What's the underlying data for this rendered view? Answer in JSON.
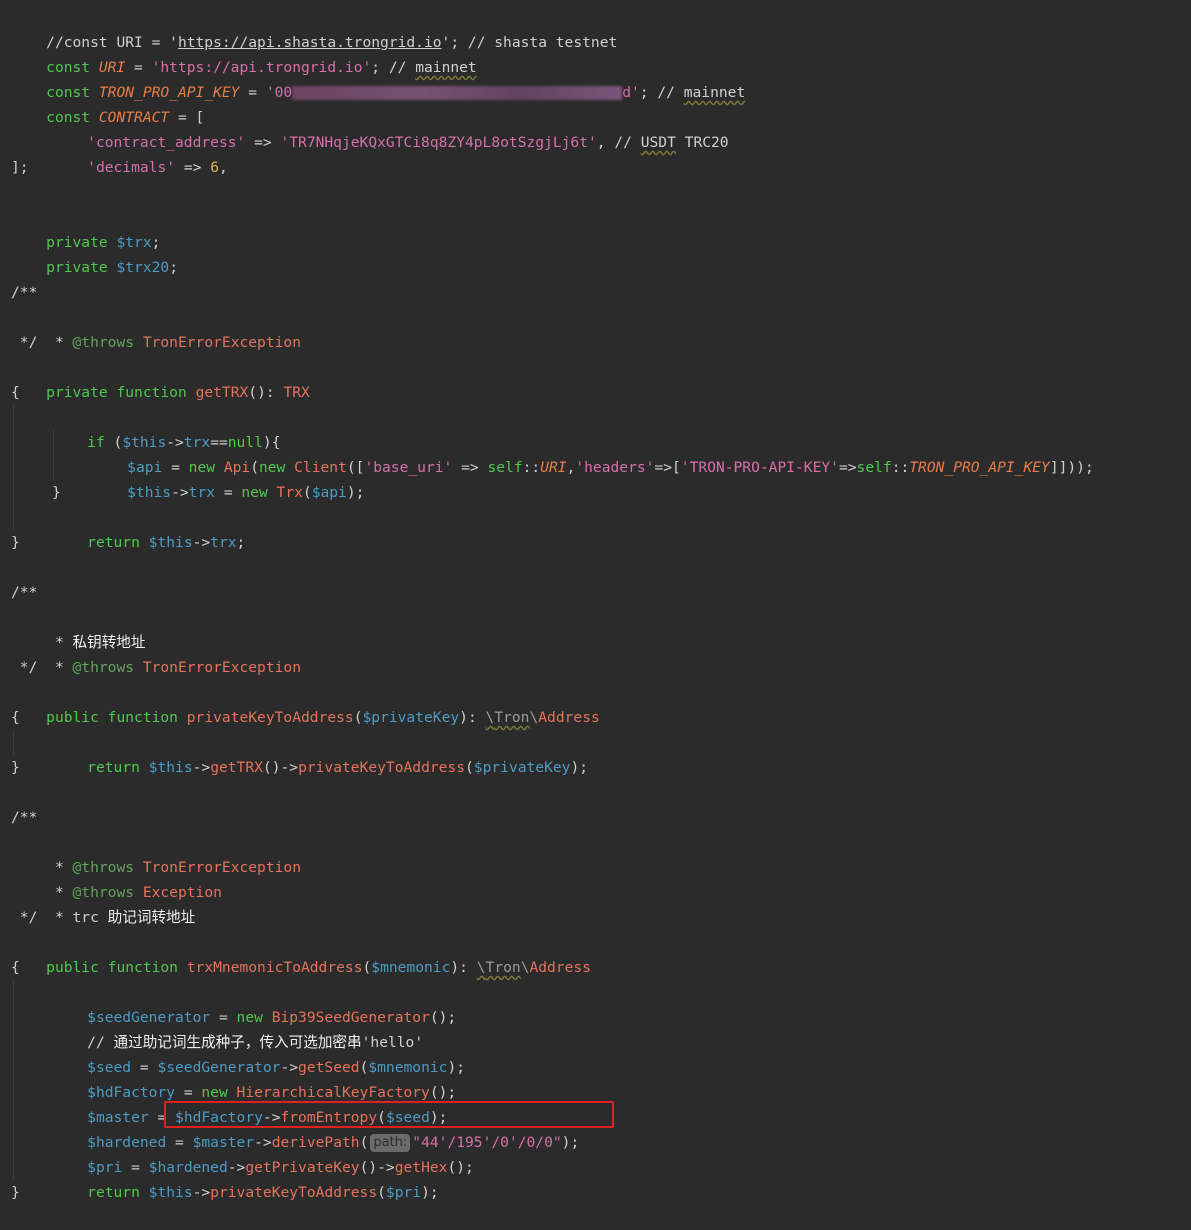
{
  "lines": {
    "l1": {
      "a": "//const URI = '",
      "b": "https://api.shasta.trongrid.io",
      "c": "'; // shasta testnet"
    },
    "l2": {
      "kw": "const",
      "name": "URI",
      "eq": " = ",
      "val": "'https://api.trongrid.io'",
      "semi": "; //",
      "comment": "mainnet"
    },
    "l3": {
      "kw": "const",
      "name": "TRON_PRO_API_KEY",
      "eq": " = ",
      "val_start": "'00",
      "val_end": "d'",
      "semi": "; //",
      "comment": "mainnet"
    },
    "l4": {
      "kw": "const",
      "name": "CONTRACT",
      "rest": " = ["
    },
    "l5": {
      "key": "'contract_address'",
      "arrow": " => ",
      "val": "'TR7NHqjeKQxGTCi8q8ZY4pL8otSzgjLj6t'",
      "semi": ", // ",
      "c1": "USDT",
      "c2": " TRC20"
    },
    "l6": {
      "key": "'decimals'",
      "arrow": " => ",
      "num": "6",
      "semi": ","
    },
    "l7": "];",
    "l9": {
      "kw": "private",
      "var": "$trx",
      "semi": ";"
    },
    "l10": {
      "kw": "private",
      "var": "$trx20",
      "semi": ";"
    },
    "l12": "/**",
    "l13": {
      "star": " * ",
      "tag": "@throws",
      "cls": "TronErrorException"
    },
    "l14": " */",
    "l15": {
      "kw1": "private",
      "kw2": "function",
      "fn": "getTRX",
      "paren": "(): ",
      "ret": "TRX"
    },
    "l16": "{",
    "l17": {
      "kw": "if",
      "p1": " (",
      "var": "$this",
      "arrow": "->",
      "prop": "trx",
      "op": "==",
      "nul": "null",
      "p2": "){"
    },
    "l18": {
      "var": "$api",
      "eq": " = ",
      "kw": "new",
      "cls1": "Api",
      "p1": "(",
      "kw2": "new",
      "cls2": "Client",
      "p2": "([",
      "k1": "'base_uri'",
      "arrow": " => ",
      "self1": "self",
      "dc1": "::",
      "c1": "URI",
      "comma": ",",
      "k2": "'headers'",
      "arrow2": "=>[",
      "k3": "'TRON-PRO-API-KEY'",
      "arrow3": "=>",
      "self2": "self",
      "dc2": "::",
      "c2": "TRON_PRO_API_KEY",
      "end": "]]));"
    },
    "l19": {
      "var": "$this",
      "arrow": "->",
      "prop": "trx",
      "eq": " = ",
      "kw": "new",
      "cls": "Trx",
      "p1": "(",
      "arg": "$api",
      "p2": ");"
    },
    "l20": "}",
    "l21": {
      "kw": "return",
      "var": "$this",
      "arrow": "->",
      "prop": "trx",
      "semi": ";"
    },
    "l22": "}",
    "l24": "/**",
    "l25": {
      "star": " * ",
      "text": "私钥转地址"
    },
    "l26": {
      "star": " * ",
      "tag": "@throws",
      "cls": "TronErrorException"
    },
    "l27": " */",
    "l28": {
      "kw1": "public",
      "kw2": "function",
      "fn": "privateKeyToAddress",
      "p1": "(",
      "arg": "$privateKey",
      "p2": "): ",
      "ns1": "\\",
      "ns2": "Tron",
      "ns3": "\\",
      "ret": "Address"
    },
    "l29": "{",
    "l30": {
      "kw": "return",
      "var": "$this",
      "arrow": "->",
      "fn1": "getTRX",
      "p1": "()->",
      "fn2": "privateKeyToAddress",
      "p2": "(",
      "arg": "$privateKey",
      "p3": ");"
    },
    "l31": "}",
    "l33": "/**",
    "l34": {
      "star": " * ",
      "tag": "@throws",
      "cls": "TronErrorException"
    },
    "l35": {
      "star": " * ",
      "tag": "@throws",
      "cls": "Exception"
    },
    "l36": {
      "star": " * ",
      "text1": "trc ",
      "text2": "助记词转地址"
    },
    "l37": " */",
    "l38": {
      "kw1": "public",
      "kw2": "function",
      "fn": "trxMnemonicToAddress",
      "p1": "(",
      "arg": "$mnemonic",
      "p2": "): ",
      "ns1": "\\",
      "ns2": "Tron",
      "ns3": "\\",
      "ret": "Address"
    },
    "l39": "{",
    "l40": {
      "var": "$seedGenerator",
      "eq": " = ",
      "kw": "new",
      "cls": "Bip39SeedGenerator",
      "p": "();"
    },
    "l41": {
      "slashes": "// ",
      "text": "通过助记词生成种子，传入可选加密串",
      "str": "'hello'"
    },
    "l42": {
      "var": "$seed",
      "eq": " = ",
      "var2": "$seedGenerator",
      "arrow": "->",
      "fn": "getSeed",
      "p1": "(",
      "arg": "$mnemonic",
      "p2": ");"
    },
    "l43": {
      "var": "$hdFactory",
      "eq": " = ",
      "kw": "new",
      "cls": "HierarchicalKeyFactory",
      "p": "();"
    },
    "l44": {
      "var": "$master",
      "eq": " = ",
      "var2": "$hdFactory",
      "arrow": "->",
      "fn": "fromEntropy",
      "p1": "(",
      "arg": "$seed",
      "p2": ");"
    },
    "l45": {
      "var": "$hardened",
      "eq": " = ",
      "var2": "$master",
      "arrow": "->",
      "fn": "derivePath",
      "p1": "(",
      "hint": "path:",
      "str": "\"44'/195'/0'/0/0\"",
      "p2": ");"
    },
    "l46": {
      "var": "$pri",
      "eq": " = ",
      "var2": "$hardened",
      "arrow": "->",
      "fn1": "getPrivateKey",
      "p1": "()->",
      "fn2": "getHex",
      "p2": "();"
    },
    "l47": {
      "kw": "return",
      "var": "$this",
      "arrow": "->",
      "fn": "privateKeyToAddress",
      "p1": "(",
      "arg": "$pri",
      "p2": ");"
    },
    "l48": "}"
  },
  "colors": {
    "background": "#2b2b2b",
    "highlight_border": "#e0221f"
  }
}
